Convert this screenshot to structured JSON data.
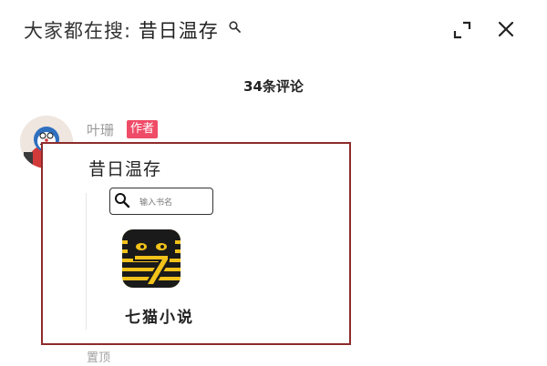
{
  "header": {
    "title_prefix": "大家都在搜: ",
    "search_keyword": "昔日温存"
  },
  "comments_header": {
    "count_label": "34条评论"
  },
  "comment": {
    "username": "叶珊",
    "author_badge": "作者",
    "card_title": "昔日温存",
    "search_placeholder": "输入书名",
    "app_name": "七猫小说",
    "pinned_label": "置顶"
  },
  "colors": {
    "badge": "#ef4c68",
    "card_border": "#8e2b2b",
    "logo_yellow": "#f2c21a"
  },
  "icons": {
    "header_search": "search-icon",
    "expand": "expand-icon",
    "close": "close-icon",
    "search_box": "search-icon",
    "app_logo": "seven-cats-logo"
  }
}
